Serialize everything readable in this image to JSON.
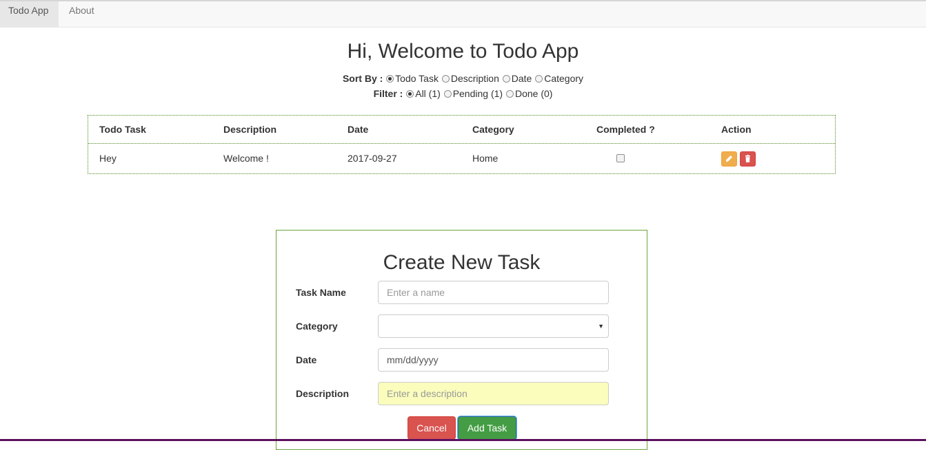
{
  "nav": {
    "items": [
      {
        "label": "Todo App"
      },
      {
        "label": "About"
      }
    ]
  },
  "page": {
    "heading": "Hi, Welcome to Todo App"
  },
  "sort": {
    "label": "Sort By :",
    "options": [
      "Todo Task",
      "Description",
      "Date",
      "Category"
    ],
    "selected": "Todo Task"
  },
  "filter": {
    "label": "Filter :",
    "options": [
      "All (1)",
      "Pending (1)",
      "Done (0)"
    ],
    "selected": "All (1)"
  },
  "table": {
    "headers": [
      "Todo Task",
      "Description",
      "Date",
      "Category",
      "Completed ?",
      "Action"
    ],
    "rows": [
      {
        "task": "Hey",
        "description": "Welcome !",
        "date": "2017-09-27",
        "category": "Home",
        "completed": false
      }
    ]
  },
  "form": {
    "title": "Create New Task",
    "task_name": {
      "label": "Task Name",
      "placeholder": "Enter a name"
    },
    "category": {
      "label": "Category",
      "value": ""
    },
    "date": {
      "label": "Date",
      "value": "mm/dd/yyyy"
    },
    "description": {
      "label": "Description",
      "placeholder": "Enter a description"
    },
    "cancel_label": "Cancel",
    "add_label": "Add Task"
  },
  "colors": {
    "accent_green": "#449d44",
    "danger_red": "#d9534f",
    "warning_orange": "#f0ad4e",
    "border_green": "#6ba53a",
    "autofill_yellow": "#fafdbc"
  }
}
